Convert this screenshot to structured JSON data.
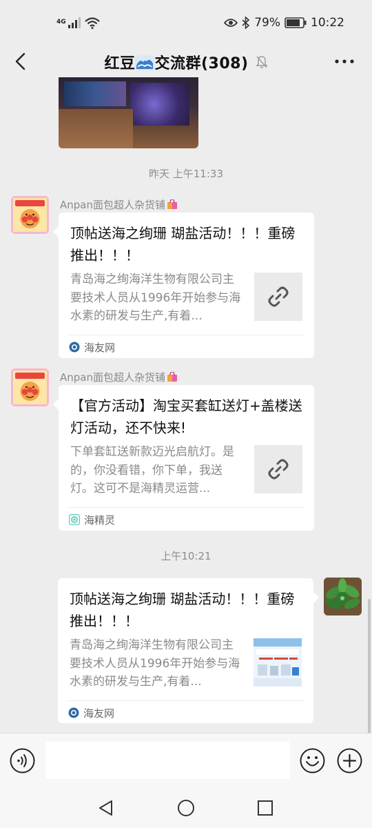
{
  "status_bar": {
    "signal_label": "4G",
    "battery": "79%",
    "time": "10:22"
  },
  "header": {
    "title_prefix": "红豆",
    "title_suffix": "交流群(308)"
  },
  "timestamps": {
    "t1": "昨天 上午11:33",
    "t2": "上午10:21"
  },
  "messages": [
    {
      "sender": "Anpan面包超人杂货铺",
      "title": "顶帖送海之绚珊 瑚盐活动！！！重磅推出！！！",
      "desc": "青岛海之绚海洋生物有限公司主要技术人员从1996年开始参与海水素的研发与生产,有着...",
      "source": "海友网"
    },
    {
      "sender": "Anpan面包超人杂货铺",
      "title": "【官方活动】淘宝买套缸送灯+盖楼送灯活动，还不快来!",
      "desc": "下单套缸送新款迈光启航灯。是的，你没看错，你下单，我送灯。这可不是海精灵运营...",
      "source": "海精灵"
    },
    {
      "sender": "",
      "title": "顶帖送海之绚珊 瑚盐活动！！！重磅推出！！！",
      "desc": "青岛海之绚海洋生物有限公司主要技术人员从1996年开始参与海水素的研发与生产,有着...",
      "source": "海友网"
    }
  ],
  "input": {
    "placeholder": ""
  },
  "colors": {
    "background": "#ededed",
    "bubble": "#ffffff",
    "timestamp": "#8c8c8c",
    "link_icon": "#555555",
    "accent": "#07c160"
  }
}
